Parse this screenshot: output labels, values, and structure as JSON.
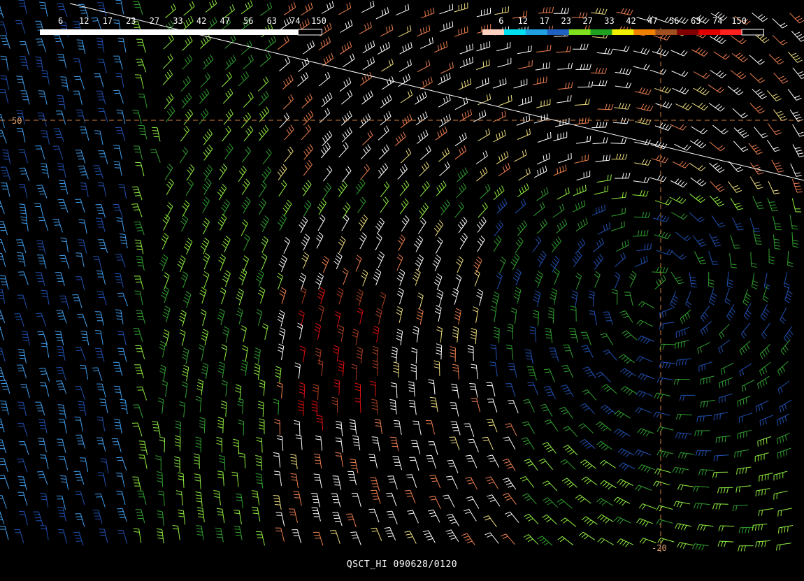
{
  "caption": "QSCT_HI 090628/0120",
  "legend_left": {
    "labels": [
      "6",
      "12",
      "17",
      "23",
      "27",
      "33",
      "42",
      "47",
      "56",
      "63",
      "74",
      "150"
    ],
    "colors": [
      "#ffffff",
      "#ffffff",
      "#ffffff",
      "#ffffff",
      "#ffffff",
      "#ffffff",
      "#ffffff",
      "#ffffff",
      "#ffffff",
      "#ffffff",
      "#ffffff",
      "#000000"
    ]
  },
  "legend_right": {
    "labels": [
      "6",
      "12",
      "17",
      "23",
      "27",
      "33",
      "42",
      "47",
      "56",
      "63",
      "74",
      "150"
    ],
    "colors": [
      "#ffd0c0",
      "#00e0f0",
      "#20a0e0",
      "#2060c0",
      "#80e020",
      "#20a020",
      "#f0f000",
      "#f08000",
      "#a05020",
      "#800000",
      "#e00000",
      "#ff2020",
      "#000000"
    ]
  },
  "grid": {
    "lat_label": "50",
    "lon_label": "-20",
    "line_color": "#d08040"
  },
  "wind_palette": {
    "blue_light": "#40a0f0",
    "blue_dark": "#2050b0",
    "green_light": "#90f040",
    "green_dark": "#30a030",
    "yellow": "#f0e080",
    "white": "#ffffff",
    "orange": "#f08050",
    "brown": "#b04020",
    "red": "#e01010"
  }
}
